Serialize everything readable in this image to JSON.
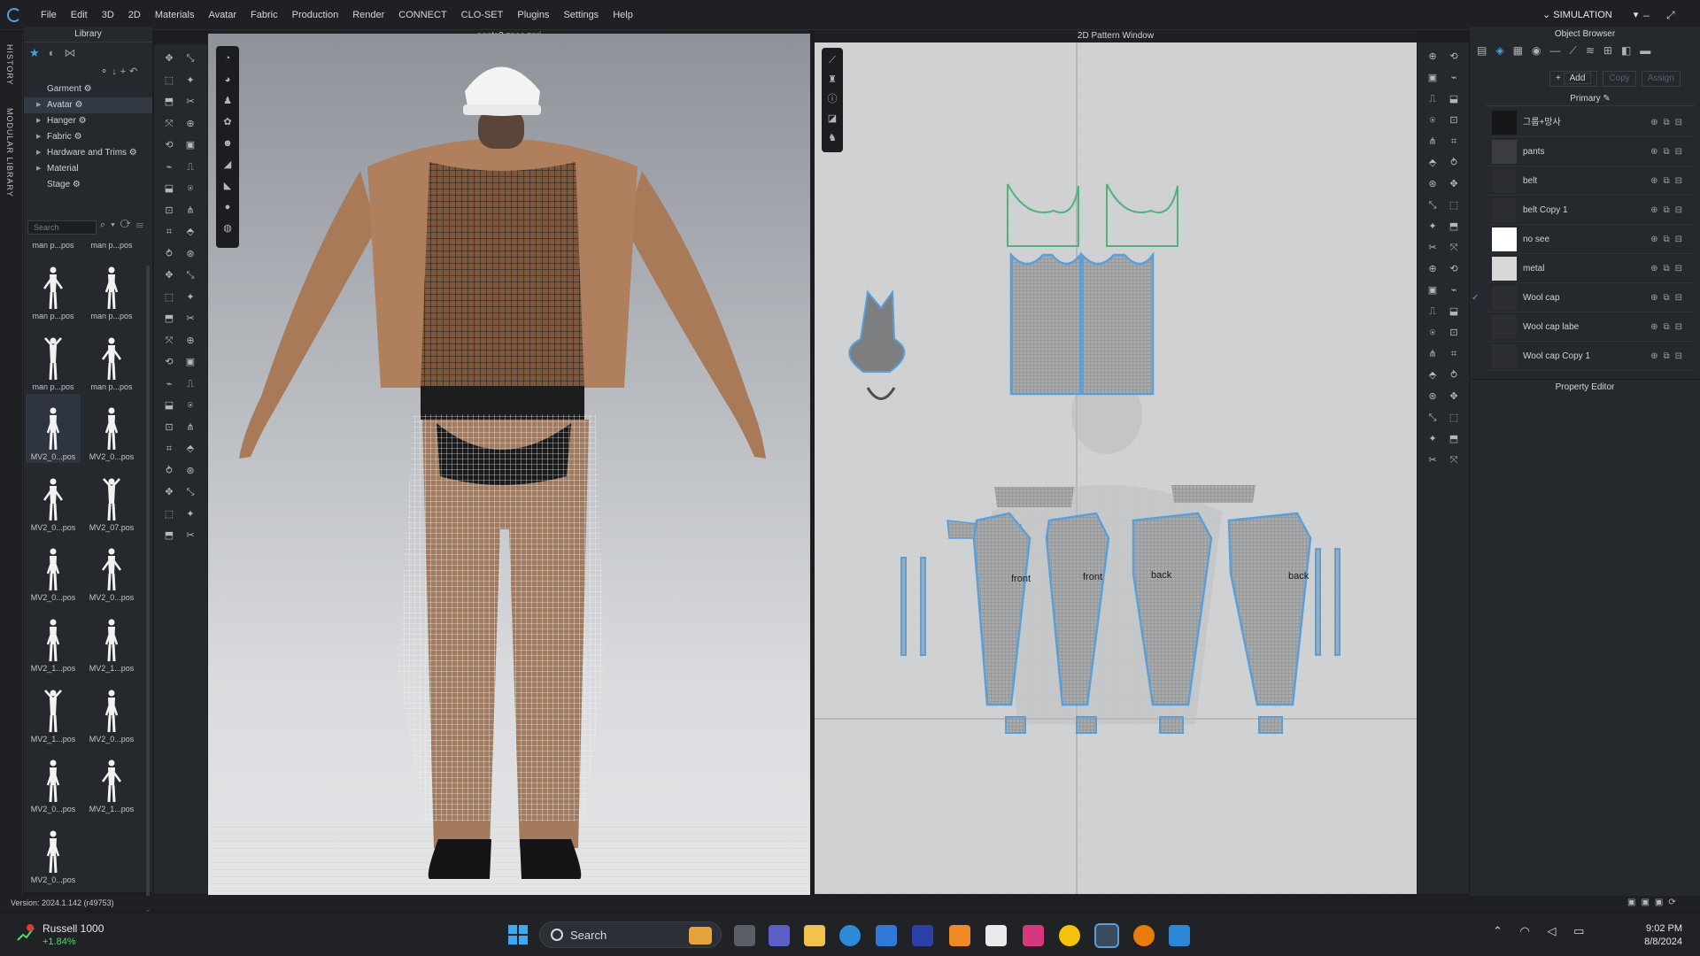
{
  "menubar": {
    "items": [
      "File",
      "Edit",
      "3D",
      "2D",
      "Materials",
      "Avatar",
      "Fabric",
      "Production",
      "Render",
      "CONNECT",
      "CLO-SET",
      "Plugins",
      "Settings",
      "Help"
    ],
    "mode": "SIMULATION",
    "window_controls": "– ⤢ ✕"
  },
  "left_tabs": {
    "history": "HISTORY",
    "modular": "MODULAR LIBRARY"
  },
  "library": {
    "title": "Library",
    "tree": [
      "Garment",
      "Avatar",
      "Hanger",
      "Fabric",
      "Hardware and Trims",
      "Material",
      "Stage"
    ],
    "search_placeholder": "Search",
    "thumbs_top_labels": [
      "man p...pos",
      "man p...pos"
    ],
    "thumbs": [
      "man p...pos",
      "man p...pos",
      "man p...pos",
      "man p...pos",
      "MV2_0...pos",
      "MV2_0...pos",
      "MV2_0...pos",
      "MV2_07.pos",
      "MV2_0...pos",
      "MV2_0...pos",
      "MV2_1...pos",
      "MV2_1...pos",
      "MV2_1...pos",
      "MV2_0...pos",
      "MV2_0...pos",
      "MV2_1...pos",
      "MV2_0...pos"
    ]
  },
  "viewport3d": {
    "title": "pants3.zpac.zprj"
  },
  "viewport2d": {
    "title": "2D Pattern Window",
    "labels": [
      "front",
      "front",
      "back",
      "back"
    ]
  },
  "object_browser": {
    "title": "Object Browser",
    "add": "Add",
    "copy": "Copy",
    "assign": "Assign",
    "group": "Primary",
    "materials": [
      {
        "name": "그룹+망사",
        "color": "#151618",
        "checked": false
      },
      {
        "name": "pants",
        "color": "#3a3c40",
        "checked": false
      },
      {
        "name": "belt",
        "color": "#2a2c30",
        "checked": false
      },
      {
        "name": "belt Copy 1",
        "color": "#2a2c30",
        "checked": false
      },
      {
        "name": "no see",
        "color": "#ffffff",
        "checked": false
      },
      {
        "name": "metal",
        "color": "#d8d8d8",
        "checked": false
      },
      {
        "name": "Wool cap",
        "color": "#2c2e32",
        "checked": true
      },
      {
        "name": "Wool cap labe",
        "color": "#2c2e32",
        "checked": false
      },
      {
        "name": "Wool cap Copy 1",
        "color": "#2c2e32",
        "checked": false
      }
    ]
  },
  "property_editor": {
    "title": "Property Editor"
  },
  "status": {
    "version": "Version: 2024.1.142 (r49753)"
  },
  "taskbar": {
    "ticker_name": "Russell 1000",
    "ticker_change": "+1.84%",
    "search_placeholder": "Search",
    "time": "9:02 PM",
    "date": "8/8/2024"
  },
  "colors": {
    "accent": "#4aa3e0",
    "panel": "#25282d",
    "pattern_outline": "#5b9fd9",
    "pattern_green": "#4fb37a"
  }
}
